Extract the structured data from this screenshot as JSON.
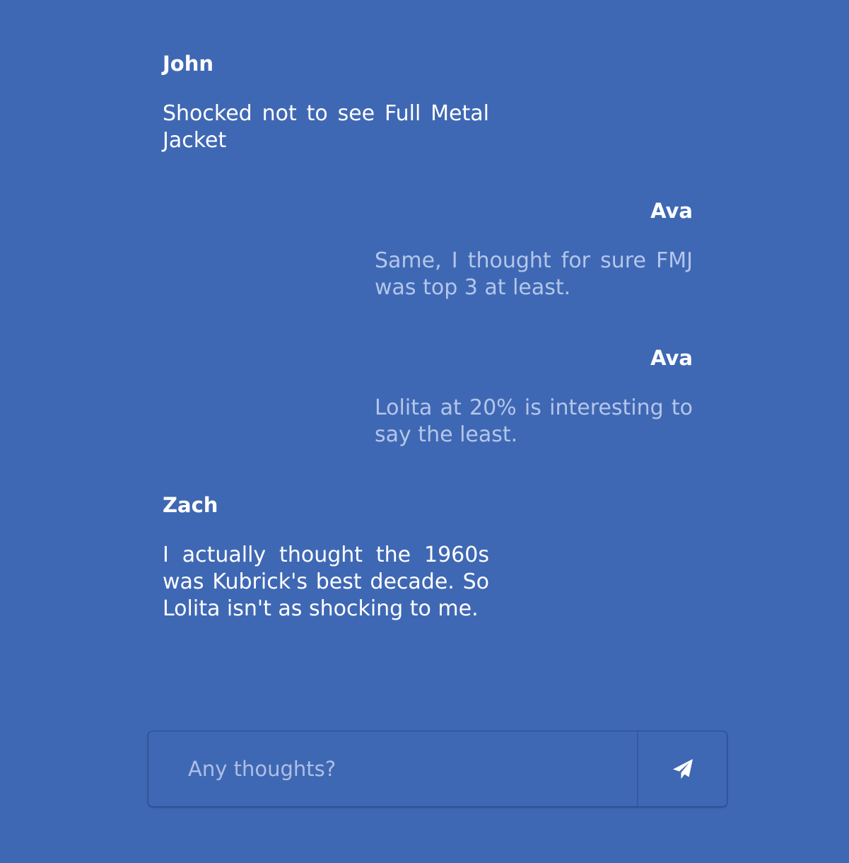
{
  "messages": [
    {
      "author": "John",
      "text": "Shocked not to see Full Metal Jacket"
    },
    {
      "author": "Ava",
      "text": "Same, I thought for sure FMJ was top 3 at least."
    },
    {
      "author": "Ava",
      "text": "Lolita at 20% is interesting to say the least."
    },
    {
      "author": "Zach",
      "text": "I actually thought the 1960s was Kubrick's best decade. So Lolita isn't as shocking to me."
    }
  ],
  "composer": {
    "placeholder": "Any thoughts?",
    "value": "",
    "send_icon": "send-icon"
  },
  "colors": {
    "background": "#3f68b4",
    "own_text": "#ffffff",
    "other_text": "#b4c6ea",
    "placeholder": "#aebfe4"
  }
}
